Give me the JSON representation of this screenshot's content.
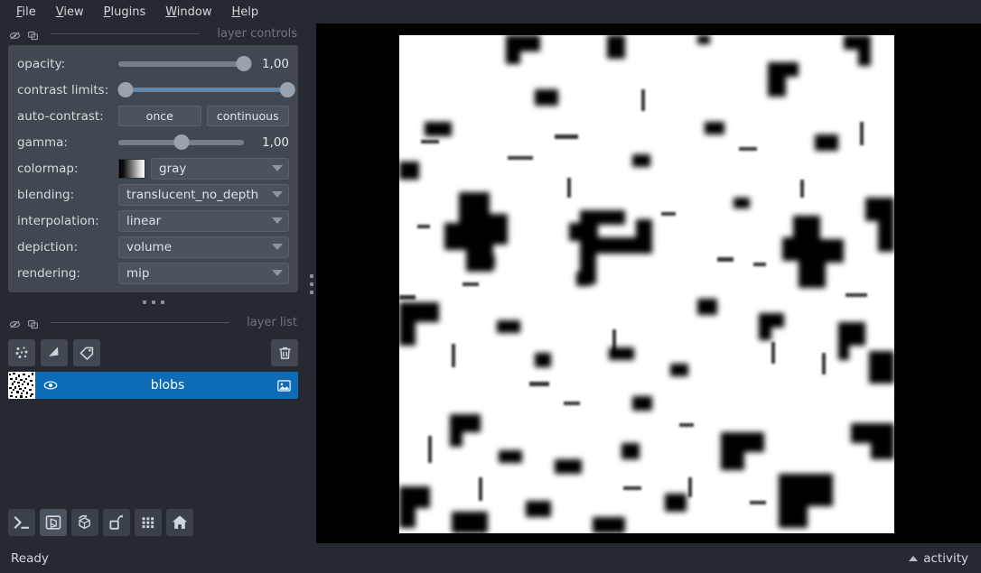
{
  "menubar": {
    "items": [
      {
        "label": "File",
        "mnemonic": "F",
        "rest": "ile"
      },
      {
        "label": "View",
        "mnemonic": "V",
        "rest": "iew"
      },
      {
        "label": "Plugins",
        "mnemonic": "P",
        "rest": "lugins"
      },
      {
        "label": "Window",
        "mnemonic": "W",
        "rest": "indow"
      },
      {
        "label": "Help",
        "mnemonic": "H",
        "rest": "elp"
      }
    ]
  },
  "layer_controls": {
    "title": "layer controls",
    "opacity": {
      "label": "opacity:",
      "value": "1,00",
      "percent": 100
    },
    "contrast_limits": {
      "label": "contrast limits:",
      "low_percent": 0,
      "high_percent": 100
    },
    "auto_contrast": {
      "label": "auto-contrast:",
      "once": "once",
      "continuous": "continuous"
    },
    "gamma": {
      "label": "gamma:",
      "value": "1,00",
      "percent": 50
    },
    "colormap": {
      "label": "colormap:",
      "value": "gray"
    },
    "blending": {
      "label": "blending:",
      "value": "translucent_no_depth"
    },
    "interpolation": {
      "label": "interpolation:",
      "value": "linear"
    },
    "depiction": {
      "label": "depiction:",
      "value": "volume"
    },
    "rendering": {
      "label": "rendering:",
      "value": "mip"
    }
  },
  "layer_list": {
    "title": "layer list",
    "buttons": [
      "new-points-button",
      "new-shapes-button",
      "new-labels-button",
      "delete-layer-button"
    ],
    "layers": [
      {
        "name": "blobs",
        "visible": true,
        "selected": true,
        "type": "image"
      }
    ]
  },
  "viewer_buttons": [
    "console-button",
    "ndisplay-button",
    "roll-dims-button",
    "transpose-dims-button",
    "grid-view-button",
    "home-button"
  ],
  "statusbar": {
    "status": "Ready",
    "activity": "activity"
  },
  "colors": {
    "background": "#262930",
    "panel": "#414851",
    "control": "#4b535e",
    "accent": "#0d6cb5",
    "slider_track": "#767f8c",
    "slider_handle": "#9aa2ae",
    "contrast_line": "#5a89b8",
    "text": "#d6dae0",
    "muted_text": "#6f757f",
    "canvas_background": "#000000",
    "image_background": "#ffffff",
    "image_blobs": "#000000"
  },
  "canvas": {
    "layer_displayed": "blobs",
    "image_description": "binary blobs — black blob regions on white background"
  }
}
